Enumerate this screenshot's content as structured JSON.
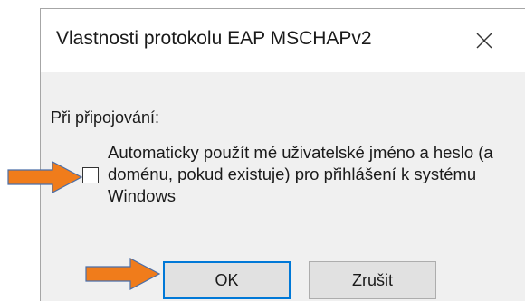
{
  "dialog": {
    "title": "Vlastnosti protokolu EAP MSCHAPv2",
    "section_label": "Při připojování:",
    "checkbox": {
      "label": "Automaticky použít mé uživatelské jméno a heslo (a doménu, pokud existuje) pro přihlášení k systému Windows",
      "checked": false
    },
    "buttons": {
      "ok": "OK",
      "cancel": "Zrušit"
    }
  },
  "icons": {
    "close": "close-icon",
    "annotation_arrow": "arrow-right-icon"
  },
  "colors": {
    "annotation_arrow": "#f07c1b",
    "annotation_arrow_outline": "#4a6ea8",
    "ok_focus_border": "#0078d7"
  }
}
